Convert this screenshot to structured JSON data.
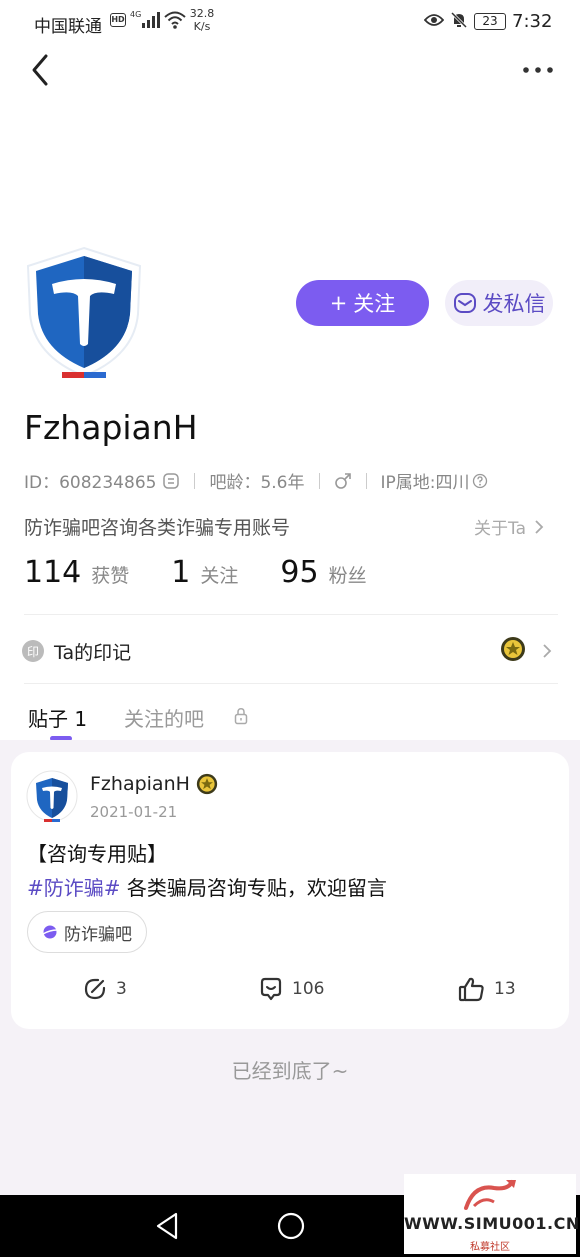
{
  "status_bar": {
    "carrier": "中国联通",
    "hd": "HD",
    "network": "4G",
    "speed_value": "32.8",
    "speed_unit": "K/s",
    "battery": "23",
    "time": "7:32"
  },
  "header": {
    "back_icon": "chevron-left-icon",
    "more_icon": "more-dots-icon"
  },
  "profile": {
    "follow_label": "关注",
    "message_label": "发私信",
    "username": "FzhapianH",
    "id_text": "ID：608234865",
    "bar_age": "吧龄：5.6年",
    "ip_location": "IP属地:四川",
    "bio": "防诈骗吧咨询各类诈骗专用账号",
    "about": "关于Ta",
    "stats": [
      {
        "num": "114",
        "label": "获赞"
      },
      {
        "num": "1",
        "label": "关注"
      },
      {
        "num": "95",
        "label": "粉丝"
      }
    ],
    "seal_badge": "印",
    "seal_label": "Ta的印记"
  },
  "tabs": {
    "posts": "贴子 1",
    "bars": "关注的吧"
  },
  "post": {
    "author": "FzhapianH",
    "date": "2021-01-21",
    "title": "【咨询专用贴】",
    "tag": "#防诈骗#",
    "body": " 各类骗局咨询专贴，欢迎留言",
    "bar_name": "防诈骗吧",
    "shares": "3",
    "comments": "106",
    "likes": "13"
  },
  "end_text": "已经到底了~",
  "watermark": {
    "text": "WWW.SIMU001.CN",
    "sub": "私募社区"
  },
  "colors": {
    "accent": "#7c5cf0",
    "message_bg": "#f1eef9",
    "feed_bg": "#f5f2f7"
  }
}
